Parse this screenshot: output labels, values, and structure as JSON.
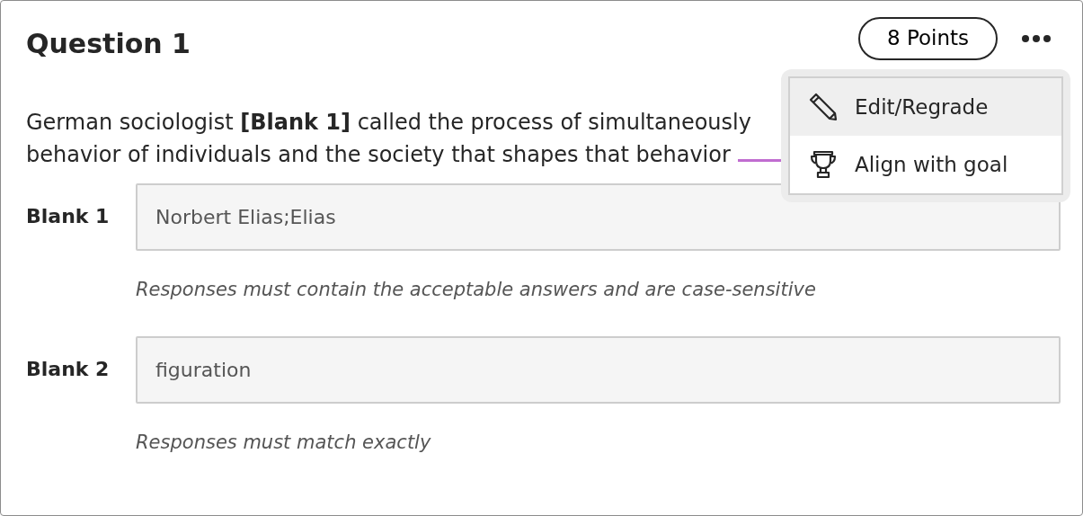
{
  "question": {
    "title": "Question 1",
    "points": "8 Points"
  },
  "text_lines": [
    "German sociologist **[Blank 1]** called the process of simultaneously",
    "behavior of individuals and the society that shapes that behavior"
  ],
  "menu": {
    "items": [
      {
        "label": "Edit/Regrade",
        "selected": true
      },
      {
        "label": "Align with goal",
        "selected": false
      }
    ]
  },
  "blanks": [
    {
      "label": "Blank 1",
      "value": "Norbert Elias;Elias",
      "hint": "Responses must contain the acceptable answers and are case-sensitive"
    },
    {
      "label": "Blank 2",
      "value": "figuration",
      "hint": "Responses must match exactly"
    }
  ]
}
